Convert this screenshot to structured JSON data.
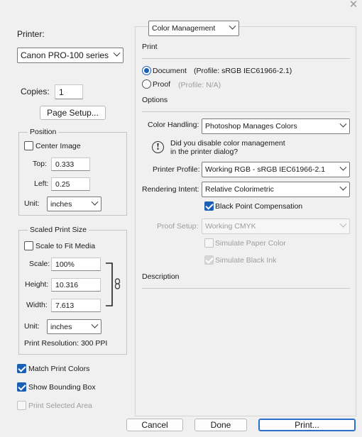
{
  "window": {
    "close_glyph": "✕"
  },
  "left": {
    "printer_label": "Printer:",
    "printer_value": "Canon PRO-100 series",
    "copies_label": "Copies:",
    "copies_value": "1",
    "page_setup": "Page Setup...",
    "position": {
      "title": "Position",
      "center_image": "Center Image",
      "center_image_checked": false,
      "top_label": "Top:",
      "top_value": "0.333",
      "left_label": "Left:",
      "left_value": "0.25",
      "unit_label": "Unit:",
      "unit_value": "inches"
    },
    "scaled": {
      "title": "Scaled Print Size",
      "scale_to_fit": "Scale to Fit Media",
      "scale_to_fit_checked": false,
      "scale_label": "Scale:",
      "scale_value": "100%",
      "height_label": "Height:",
      "height_value": "10.316",
      "width_label": "Width:",
      "width_value": "7.613",
      "unit_label": "Unit:",
      "unit_value": "inches",
      "resolution": "Print Resolution: 300 PPI"
    },
    "match_print_colors": "Match Print Colors",
    "match_print_colors_checked": true,
    "show_bounding_box": "Show Bounding Box",
    "show_bounding_box_checked": true,
    "print_selected_area": "Print Selected Area",
    "print_selected_area_checked": false
  },
  "right": {
    "section_select": "Color Management",
    "print_heading": "Print",
    "document_label": "Document",
    "document_profile": "(Profile: sRGB IEC61966-2.1)",
    "document_selected": true,
    "proof_label": "Proof",
    "proof_profile": "(Profile: N/A)",
    "options_heading": "Options",
    "color_handling_label": "Color Handling:",
    "color_handling_value": "Photoshop Manages Colors",
    "info_glyph": "!",
    "info_line1": "Did you disable color management",
    "info_line2": "in the printer dialog?",
    "printer_profile_label": "Printer Profile:",
    "printer_profile_value": "Working RGB - sRGB IEC61966-2.1",
    "rendering_intent_label": "Rendering Intent:",
    "rendering_intent_value": "Relative Colorimetric",
    "black_point": "Black Point Compensation",
    "black_point_checked": true,
    "proof_setup_label": "Proof Setup:",
    "proof_setup_value": "Working CMYK",
    "simulate_paper": "Simulate Paper Color",
    "simulate_black": "Simulate Black Ink",
    "description_heading": "Description"
  },
  "buttons": {
    "cancel": "Cancel",
    "done": "Done",
    "print": "Print..."
  },
  "colors": {
    "accent": "#1a5fb4",
    "background": "#f0f0f0",
    "disabled_text": "#9d9d9d"
  }
}
